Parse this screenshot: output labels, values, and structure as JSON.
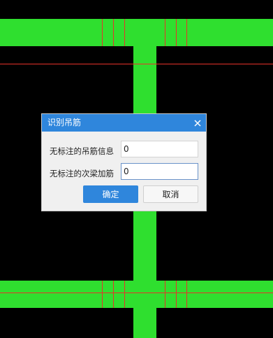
{
  "dialog": {
    "title": "识别吊筋",
    "close_icon": "close-icon",
    "fields": [
      {
        "label": "无标注的吊筋信息",
        "value": "0"
      },
      {
        "label": "无标注的次梁加筋",
        "value": "0"
      }
    ],
    "ok_label": "确定",
    "cancel_label": "取消"
  },
  "colors": {
    "background": "#000000",
    "beam": "#2fdf2f",
    "rebar_line": "#e8312a",
    "accent": "#2f86dc",
    "dialog_bg": "#f0f0f0"
  }
}
